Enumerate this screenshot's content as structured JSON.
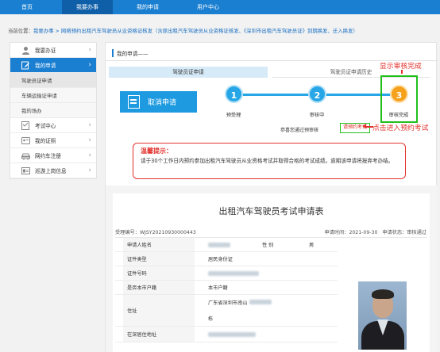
{
  "nav": {
    "items": [
      "首页",
      "我要办事",
      "我的申请",
      "用户中心"
    ],
    "active_index": 1
  },
  "breadcrumb": {
    "prefix": "当前位置：",
    "path": "我要办事 > 网络预约出租汽车驾驶员从业资格证核发（含原出租汽车驾驶员从业资格证核发、《深圳市出租汽车驾驶员证》到期换发、迁入换发）"
  },
  "sidebar": {
    "items": [
      {
        "label": "我要办证",
        "icon": "user-icon",
        "active": false
      },
      {
        "label": "我的申请",
        "icon": "edit-icon",
        "active": true
      },
      {
        "label": "考试中心",
        "icon": "checklist-icon",
        "active": false
      },
      {
        "label": "我的证照",
        "icon": "card-icon",
        "active": false
      },
      {
        "label": "网约车注册",
        "icon": "car-icon",
        "active": false
      },
      {
        "label": "巡游上岗信息",
        "icon": "id-card-icon",
        "active": false
      }
    ],
    "subitems": [
      "驾驶员证申请",
      "车辆运输证申请",
      "我的场办"
    ],
    "current_sub": 0
  },
  "main": {
    "title": "我的申请——",
    "tabs": [
      "驾驶员证申请",
      "驾驶员证申请历史"
    ],
    "cancel_label": "取消申请",
    "steps": [
      {
        "num": "1",
        "label": "预受理"
      },
      {
        "num": "2",
        "label": "审核中"
      },
      {
        "num": "3",
        "label": "审核完成"
      }
    ],
    "congrats": "恭喜您通过预审核",
    "reserve_label": "请预约考试",
    "tip_title": "温馨提示：",
    "tip_text": "请于30个工作日内预约参加出租汽车驾驶员从业资格考试并取得合格的考试成绩。逾期该申请将按弃考办结。"
  },
  "form": {
    "title": "出租汽车驾驶员考试申请表",
    "id_label": "受理编号：",
    "id_value": "WJSY20210930000443",
    "time_label": "申请时间：",
    "time_value": "2021-09-30",
    "status_label": "申请状态：",
    "status_value": "审核通过",
    "rows": [
      {
        "label": "申请人姓名",
        "value": "",
        "label2": "性 别",
        "value2": "男"
      },
      {
        "label": "证件类型",
        "value": "居民身份证"
      },
      {
        "label": "证件号码",
        "value": ""
      },
      {
        "label": "是否本市户籍",
        "value": "本市户籍"
      },
      {
        "label": "住址",
        "value": "广东省深圳市南山",
        "value_b": "栋"
      },
      {
        "label": "在深居住地址",
        "value": ""
      }
    ]
  },
  "annotations": {
    "review_done": "显示审核完成",
    "click_reserve": "点击进入预约考试"
  },
  "colors": {
    "nav_blue": "#1a7fd1",
    "step_blue": "#26a6e6",
    "step_orange": "#f5a11b",
    "highlight_green": "#22c01d",
    "alert_red": "#e2312b"
  }
}
